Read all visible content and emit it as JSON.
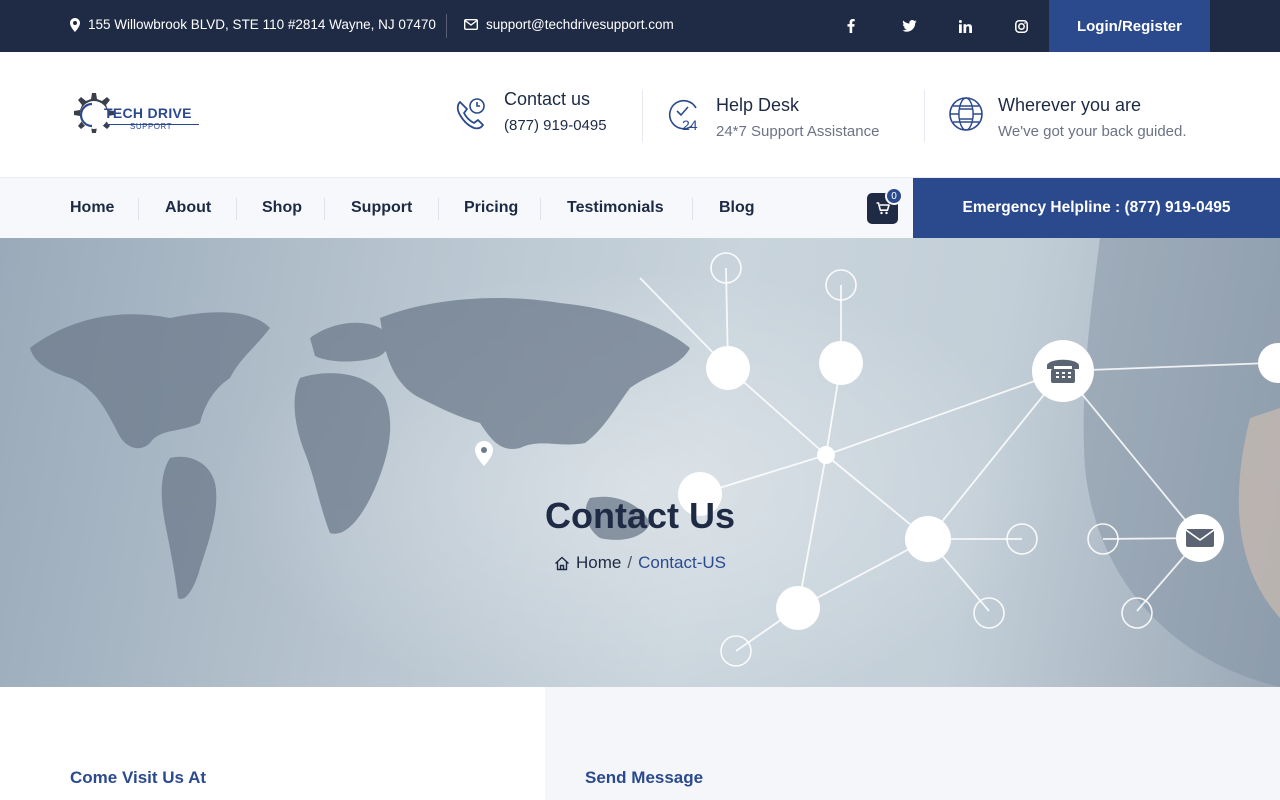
{
  "topbar": {
    "address": "155 Willowbrook BLVD, STE 110 #2814 Wayne, NJ 07470",
    "email": "support@techdrivesupport.com",
    "social": [
      "f",
      "t",
      "in",
      "ig"
    ],
    "login_label": "Login/Register"
  },
  "header": {
    "logo_text": "TECH DRIVE",
    "logo_sub": "SUPPORT",
    "contact": {
      "title": "Contact us",
      "sub": "(877) 919-0495"
    },
    "helpdesk": {
      "title": "Help Desk",
      "sub": "24*7 Support Assistance"
    },
    "wherever": {
      "title": "Wherever you are",
      "sub": "We've got your back guided."
    }
  },
  "nav": {
    "items": [
      "Home",
      "About",
      "Shop",
      "Support",
      "Pricing",
      "Testimonials",
      "Blog"
    ],
    "cart_count": "0",
    "helpline": "Emergency Helpline : (877) 919-0495"
  },
  "hero": {
    "title": "Contact Us",
    "breadcrumb_home": "Home",
    "breadcrumb_sep": "/",
    "breadcrumb_current": "Contact-US"
  },
  "sections": {
    "visit_title": "Come Visit Us At",
    "message_title": "Send Message"
  },
  "colors": {
    "dark_navy": "#1f2b45",
    "brand_blue": "#2b4a8e",
    "muted_text": "#6b7384"
  }
}
